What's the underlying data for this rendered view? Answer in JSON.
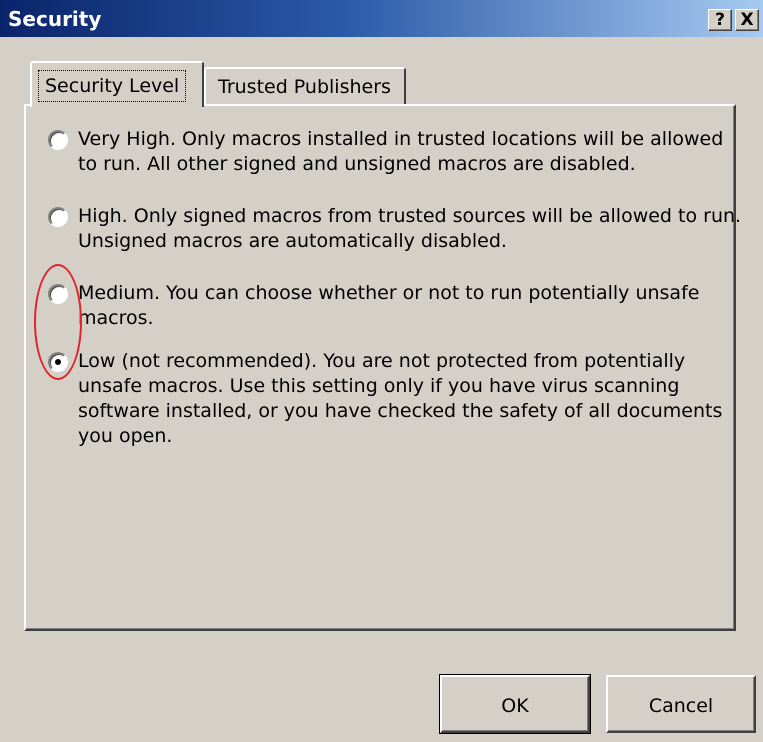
{
  "window": {
    "title": "Security",
    "help_button": "?",
    "close_button": "X"
  },
  "tabs": [
    {
      "label": "Security Level",
      "active": true
    },
    {
      "label": "Trusted Publishers",
      "active": false
    }
  ],
  "options": [
    {
      "label": "Very High. Only macros installed in trusted locations will be allowed to run. All other signed and unsigned macros are disabled.",
      "checked": false
    },
    {
      "label": "High. Only signed macros from trusted sources will be allowed to run. Unsigned macros are automatically disabled.",
      "checked": false
    },
    {
      "label": "Medium. You can choose whether or not to run potentially unsafe macros.",
      "checked": false
    },
    {
      "label": "Low (not recommended). You are not protected from potentially unsafe macros. Use this setting only if you have virus scanning software installed, or you have checked the safety of all documents you open.",
      "checked": true
    }
  ],
  "buttons": {
    "ok": "OK",
    "cancel": "Cancel"
  },
  "colors": {
    "annotation_circle": "#e0242a",
    "title_bar": "#0a246a",
    "dialog_bg": "#d4d0c8"
  }
}
